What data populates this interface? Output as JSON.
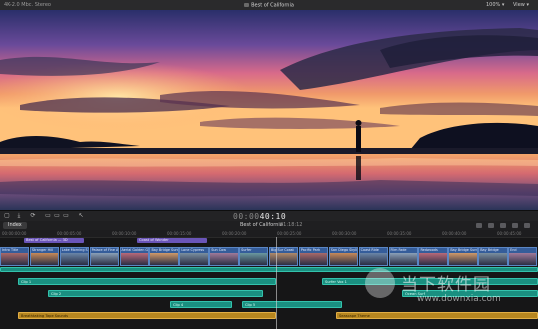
{
  "topbar": {
    "library": "4K-2.0 Mbc. Stereo",
    "title": "Best of California",
    "zoom": "100% ▾",
    "view": "View ▾"
  },
  "toolbar": {
    "timecode_dim": "00:00",
    "timecode": "40:10",
    "icons": [
      "clip-appearance-icon",
      "select-tool-icon",
      "transform-icon",
      "append-icon",
      "connect-icon",
      "insert-icon",
      "overwrite-icon",
      "arrow-tool-icon"
    ]
  },
  "indexbar": {
    "index_label": "Index",
    "project": "Best of California",
    "duration": "01:18:12",
    "right_icons": [
      "audio-meter-icon",
      "headphones-icon",
      "skimming-icon",
      "snapping-icon",
      "zoom-icon"
    ]
  },
  "timeline": {
    "ruler": [
      "00:00:00:00",
      "00:00:05:00",
      "00:00:10:00",
      "00:00:15:00",
      "00:00:20:00",
      "00:00:25:00",
      "00:00:30:00",
      "00:00:35:00",
      "00:00:40:00",
      "00:00:45:00"
    ],
    "markers": [
      {
        "label": "Best of California — 3D",
        "color": "#6a55b8"
      },
      {
        "label": "Coast of Wonder",
        "color": "#6a55b8"
      }
    ],
    "clips": [
      "Intro Title",
      "Stranger Hill",
      "Lake Morning Sun",
      "Palace of Fine Arts",
      "Aerial Golden Gate",
      "Bay Bridge Sunset",
      "Lone Cypress",
      "Sun Cow",
      "Surfer",
      "Big Sur Coast",
      "Pacific Park",
      "San Diego Skyline",
      "Coast Ride",
      "Film Fade",
      "Redwoods",
      "Bay Bridge Sunset 2",
      "Bay Bridge",
      "End"
    ],
    "audio": [
      {
        "label": "Clip 1",
        "color": "teal"
      },
      {
        "label": "Clip 2",
        "color": "teal"
      },
      {
        "label": "Surfer Vox 1",
        "color": "teal"
      },
      {
        "label": "Clip 4",
        "color": "teal"
      },
      {
        "label": "Clip 5",
        "color": "teal"
      },
      {
        "label": "Ocean Surf",
        "color": "teal"
      },
      {
        "label": "Breathtaking Tape Sounds",
        "color": "orange"
      },
      {
        "label": "Seascape Theme",
        "color": "orange"
      }
    ]
  },
  "watermark": {
    "text": "当下软件园",
    "url": "www.downxia.com"
  }
}
